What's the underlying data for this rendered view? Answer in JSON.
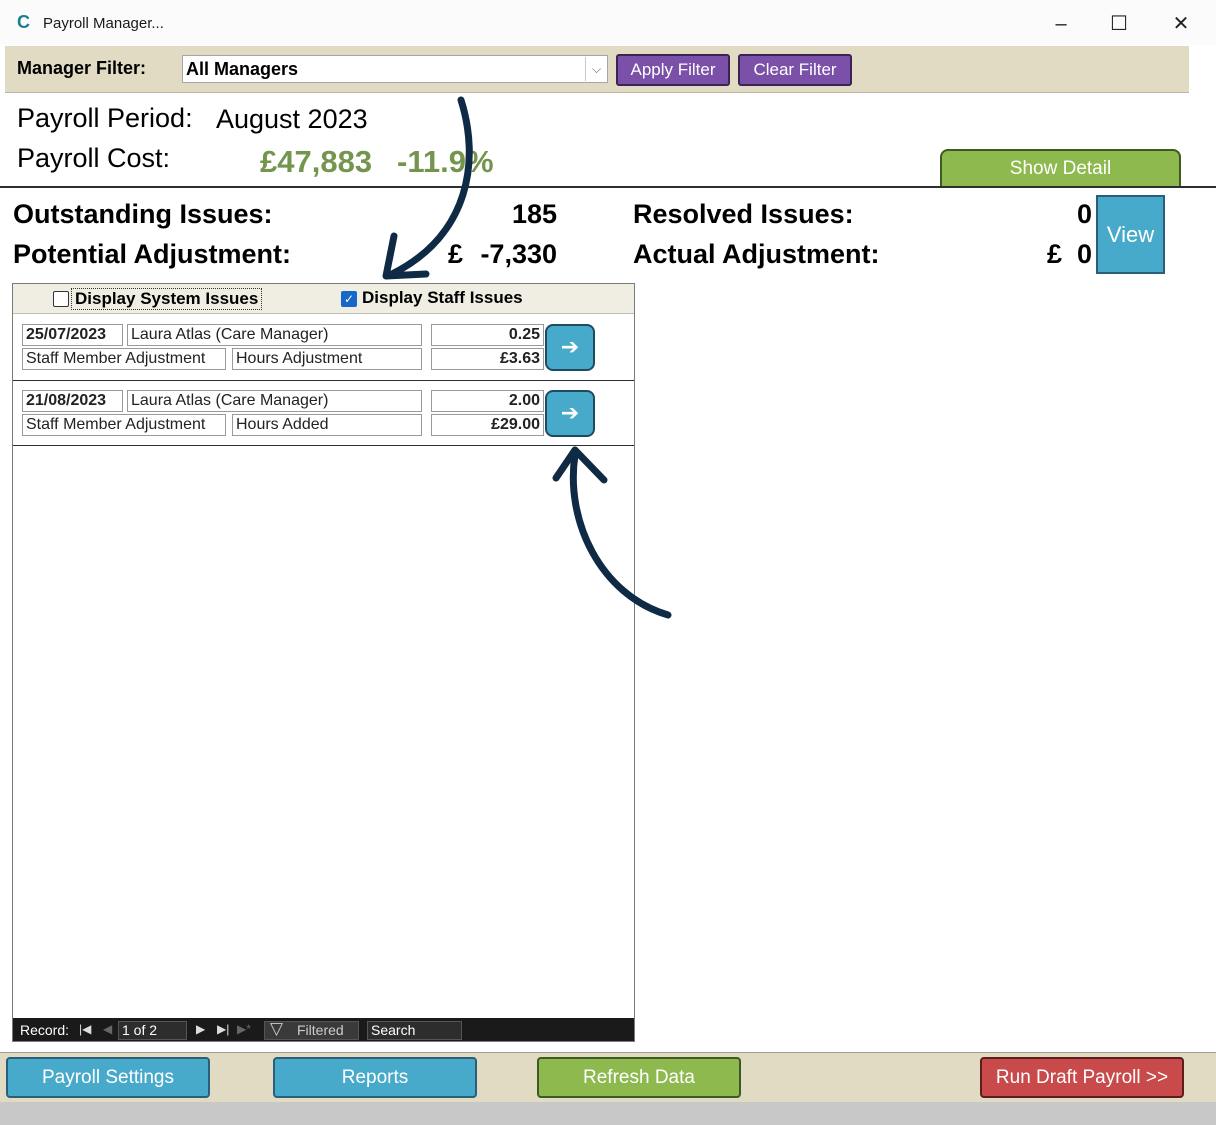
{
  "window": {
    "title": "Payroll Manager...",
    "app_icon": "C",
    "minimize_glyph": "–",
    "maximize_glyph": "☐",
    "close_glyph": "✕"
  },
  "filter": {
    "label": "Manager Filter:",
    "selected": "All Managers",
    "dropdown_glyph": "⌵",
    "apply_label": "Apply Filter",
    "clear_label": "Clear Filter"
  },
  "period": {
    "period_label": "Payroll Period:",
    "period_value": "August 2023",
    "cost_label": "Payroll  Cost:",
    "cost_value": "£47,883",
    "cost_change": "-11.9%",
    "show_detail_label": "Show Detail"
  },
  "stats": {
    "outstanding_label": "Outstanding Issues:",
    "outstanding_value": "185",
    "potential_label": "Potential Adjustment:",
    "potential_currency": "£",
    "potential_value": "-7,330",
    "resolved_label": "Resolved Issues:",
    "resolved_value": "0",
    "actual_label": "Actual Adjustment:",
    "actual_currency": "£",
    "actual_value": "0",
    "view_label": "View"
  },
  "issues": {
    "display_system_label": "Display System Issues",
    "display_system_checked": false,
    "display_staff_label": "Display  Staff Issues",
    "display_staff_checked": true,
    "check_glyph": "✓",
    "arrow_glyph": "➔",
    "rows": [
      {
        "date": "25/07/2023",
        "person": "Laura Atlas (Care Manager)",
        "quantity": "0.25",
        "category": "Staff Member Adjustment",
        "type": "Hours Adjustment",
        "amount": "£3.63"
      },
      {
        "date": "21/08/2023",
        "person": "Laura Atlas (Care Manager)",
        "quantity": "2.00",
        "category": "Staff Member Adjustment",
        "type": "Hours Added",
        "amount": "£29.00"
      }
    ]
  },
  "navigator": {
    "record_label": "Record:",
    "first_glyph": "|◀",
    "prev_glyph": "◀",
    "position": "1 of 2",
    "next_glyph": "▶",
    "last_glyph": "▶|",
    "new_glyph": "▶*",
    "filter_icon_glyph": "▽",
    "filtered_label": "Filtered",
    "search_placeholder": "Search"
  },
  "footer": {
    "settings_label": "Payroll Settings",
    "reports_label": "Reports",
    "refresh_label": "Refresh Data",
    "run_label": "Run Draft Payroll >>"
  },
  "colors": {
    "accent_blue": "#48aacb",
    "accent_green": "#8db94e",
    "accent_purple": "#7b50a8",
    "accent_red": "#c84a4a",
    "cost_green": "#73954e",
    "annotation_navy": "#0f2a44"
  }
}
